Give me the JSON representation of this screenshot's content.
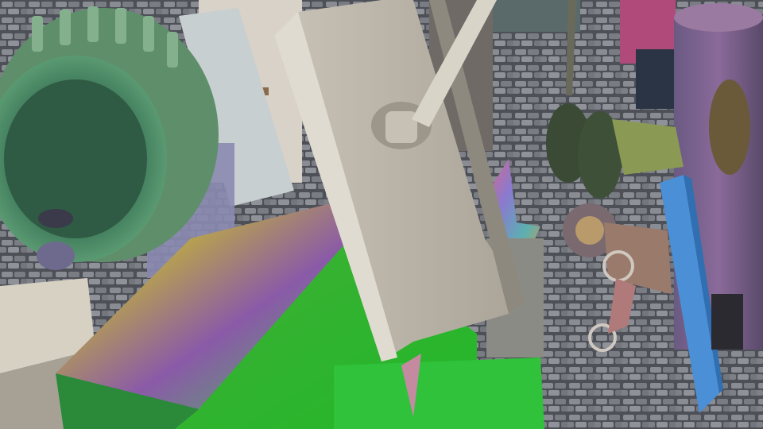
{
  "scene": {
    "kind": "3d-render",
    "palette": {
      "cobblestone": "#7c7e86",
      "cobble_mortar": "#4e5058",
      "steel_beam": "#bdb7ab",
      "green_wheel": "#6f9a77",
      "green_block": "#39c23a",
      "blue_post": "#4b8fd6",
      "purple_cylinder": "#7a6a8a",
      "rust_gear": "#9a7a6a"
    }
  }
}
